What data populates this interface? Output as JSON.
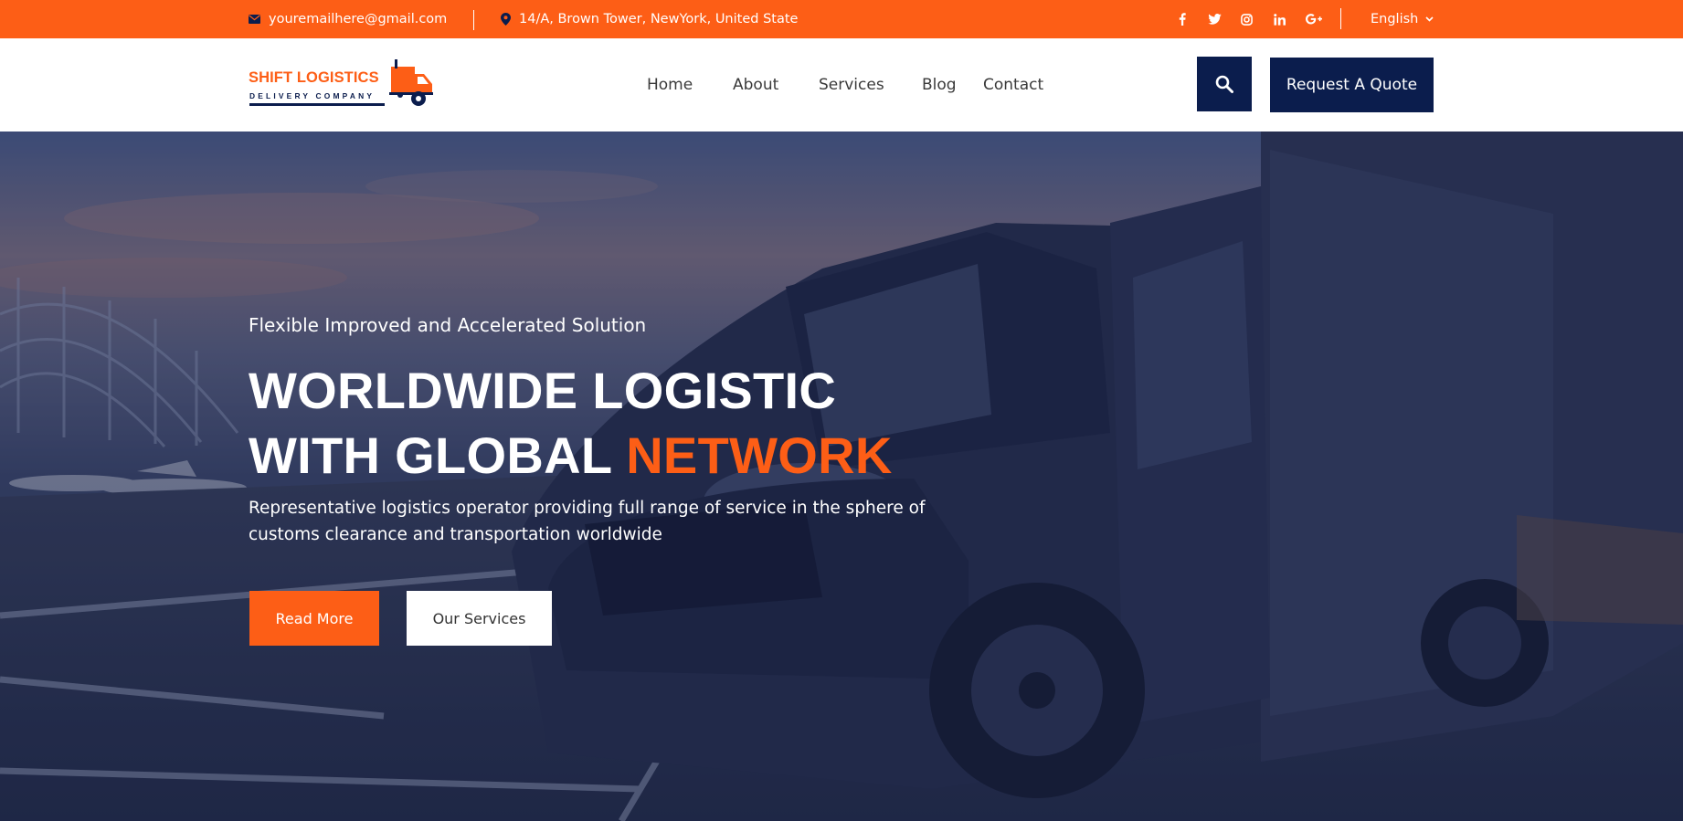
{
  "colors": {
    "accent": "#fd5e16",
    "navy": "#0b1d4d",
    "white": "#ffffff"
  },
  "topbar": {
    "email": "youremailhere@gmail.com",
    "email_icon": "envelope-icon",
    "address": "14/A, Brown Tower, NewYork, United State",
    "address_icon": "map-marker-icon",
    "social": [
      {
        "name": "facebook",
        "icon": "facebook-icon"
      },
      {
        "name": "twitter",
        "icon": "twitter-icon"
      },
      {
        "name": "instagram",
        "icon": "instagram-icon"
      },
      {
        "name": "linkedin",
        "icon": "linkedin-icon"
      },
      {
        "name": "google-plus",
        "icon": "google-plus-icon"
      }
    ],
    "language": "English"
  },
  "header": {
    "logo": {
      "title": "SHIFT LOGISTICS",
      "subtitle": "DELIVERY COMPANY"
    },
    "nav": [
      "Home",
      "About",
      "Services",
      "Blog",
      "Contact"
    ],
    "search_icon": "search-icon",
    "quote_label": "Request A Quote"
  },
  "hero": {
    "subtitle": "Flexible Improved and Accelerated Solution",
    "headline_line1": "WORLDWIDE LOGISTIC",
    "headline_line2_prefix": "WITH GLOBAL ",
    "headline_line2_accent": "NETWORK",
    "description": "Representative logistics operator providing full range of service in the sphere of customs clearance and transportation worldwide",
    "primary_button": "Read More",
    "secondary_button": "Our Services"
  }
}
